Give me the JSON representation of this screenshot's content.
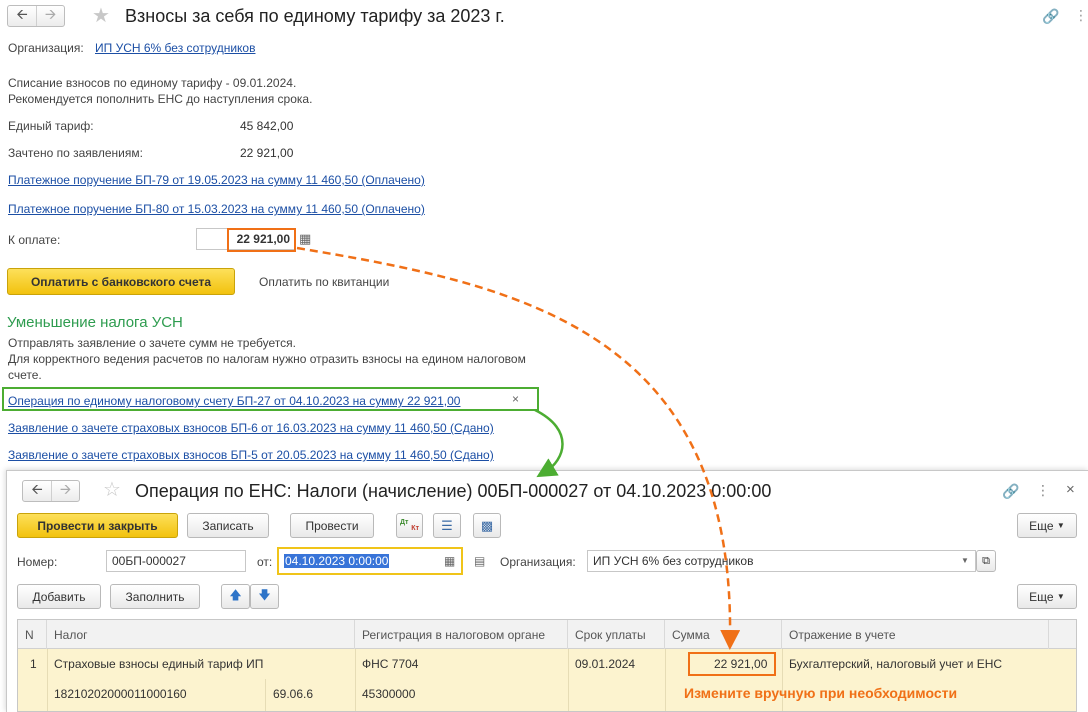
{
  "main": {
    "title": "Взносы за себя по единому тарифу за 2023 г.",
    "org_label": "Организация:",
    "org_value": "ИП УСН 6% без сотрудников",
    "info_line1": "Списание взносов по единому тарифу - 09.01.2024.",
    "info_line2": "Рекомендуется пополнить ЕНС до наступления срока.",
    "tariff_label": "Единый тариф:",
    "tariff_value": "45 842,00",
    "credited_label": "Зачтено по заявлениям:",
    "credited_value": "22 921,00",
    "payment_link1": "Платежное поручение БП-79 от 19.05.2023 на сумму 11 460,50 (Оплачено)",
    "payment_link2": "Платежное поручение БП-80 от 15.03.2023 на сумму 11 460,50 (Оплачено)",
    "to_pay_label": "К оплате:",
    "to_pay_value": "22 921,00",
    "pay_bank_button": "Оплатить с банковского счета",
    "pay_receipt_link": "Оплатить по квитанции",
    "usn_heading": "Уменьшение налога УСН",
    "usn_text1": "Отправлять заявление о зачете сумм не требуется.",
    "usn_text2": "Для корректного ведения расчетов по налогам нужно отразить взносы на едином налоговом",
    "usn_text3": "счете.",
    "ens_operation_link": "Операция по единому налоговому счету БП-27 от 04.10.2023 на сумму 22 921,00",
    "statement_link1": "Заявление о зачете страховых взносов БП-6 от 16.03.2023 на сумму 11 460,50 (Сдано)",
    "statement_link2": "Заявление о зачете страховых взносов БП-5 от 20.05.2023 на сумму 11 460,50 (Сдано)"
  },
  "doc": {
    "title": "Операция по ЕНС: Налоги (начисление) 00БП-000027 от 04.10.2023 0:00:00",
    "post_close_button": "Провести и закрыть",
    "save_button": "Записать",
    "post_button": "Провести",
    "dtkt_dt": "Дт",
    "dtkt_kt": "Кт",
    "more_button": "Еще",
    "number_label": "Номер:",
    "number_value": "00БП-000027",
    "from_label": "от:",
    "date_value": "04.10.2023  0:00:00",
    "org_label": "Организация:",
    "org_value": "ИП УСН 6% без сотрудников",
    "add_button": "Добавить",
    "fill_button": "Заполнить",
    "more_button2": "Еще"
  },
  "table": {
    "headers": [
      "N",
      "Налог",
      "Регистрация в налоговом органе",
      "Срок уплаты",
      "Сумма",
      "Отражение в учете"
    ],
    "row": {
      "n": "1",
      "tax": "Страховые взносы единый тариф ИП",
      "kbk": "18210202000011000160",
      "article": "69.06.6",
      "registration": "ФНС 7704",
      "oktmo": "45300000",
      "due": "09.01.2024",
      "amount": "22 921,00",
      "reflection": "Бухгалтерский, налоговый учет и ЕНС"
    }
  },
  "annotation": {
    "note": "Измените вручную при необходимости",
    "orange": "#f07017",
    "green": "#4cad32"
  }
}
